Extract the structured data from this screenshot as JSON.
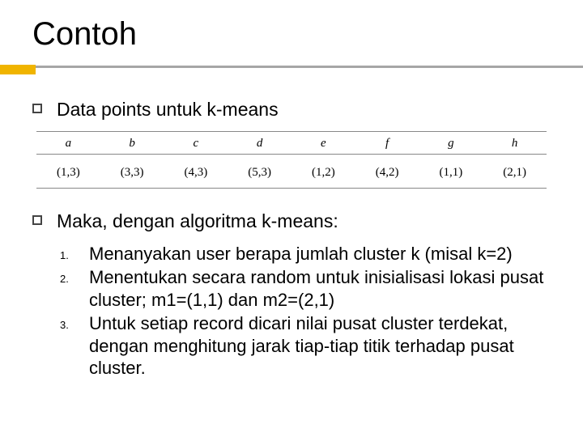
{
  "title": "Contoh",
  "bullet1": "Data points untuk k-means",
  "bullet2": "Maka, dengan algoritma k-means:",
  "chart_data": {
    "type": "table",
    "columns": [
      "a",
      "b",
      "c",
      "d",
      "e",
      "f",
      "g",
      "h"
    ],
    "rows": [
      [
        "(1,3)",
        "(3,3)",
        "(4,3)",
        "(5,3)",
        "(1,2)",
        "(4,2)",
        "(1,1)",
        "(2,1)"
      ]
    ]
  },
  "steps": [
    {
      "num": "1.",
      "text": "Menanyakan user berapa jumlah cluster k (misal k=2)"
    },
    {
      "num": "2.",
      "text": "Menentukan secara random untuk inisialisasi lokasi pusat cluster; m1=(1,1) dan m2=(2,1)"
    },
    {
      "num": "3.",
      "text": "Untuk setiap record dicari nilai pusat cluster terdekat, dengan menghitung jarak tiap-tiap titik terhadap pusat cluster."
    }
  ]
}
